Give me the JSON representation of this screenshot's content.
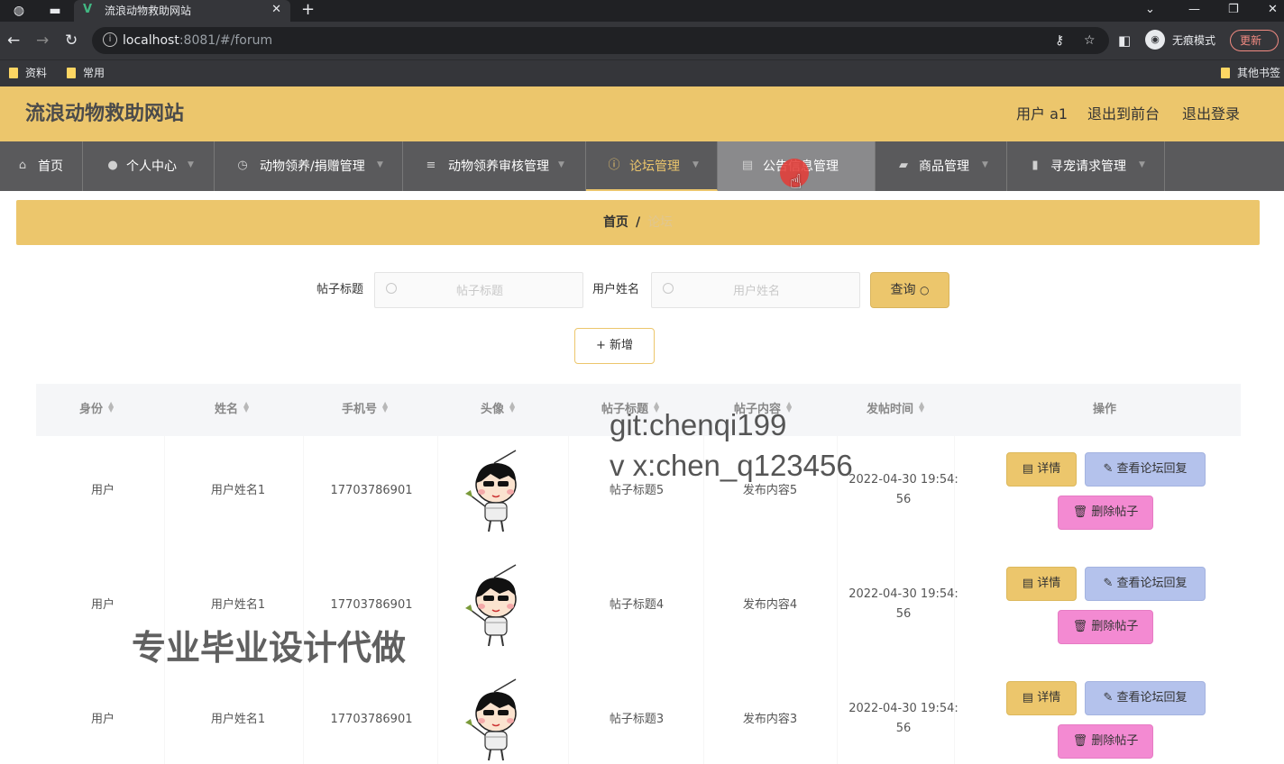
{
  "browser": {
    "tab_title": "流浪动物救助网站",
    "url_host": "localhost",
    "url_rest": ":8081/#/forum",
    "incognito_label": "无痕模式",
    "update_label": "更新",
    "bookmarks": [
      "资料",
      "常用"
    ],
    "other_bookmarks": "其他书签"
  },
  "header": {
    "site_title": "流浪动物救助网站",
    "user_label": "用户 a1",
    "back_to_front": "退出到前台",
    "logout": "退出登录"
  },
  "menu": [
    {
      "label": "首页",
      "icon": "home-icon"
    },
    {
      "label": "个人中心",
      "icon": "user-icon"
    },
    {
      "label": "动物领养/捐赠管理",
      "icon": "clock-icon"
    },
    {
      "label": "动物领养审核管理",
      "icon": "list-icon"
    },
    {
      "label": "论坛管理",
      "icon": "info-icon"
    },
    {
      "label": "公告信息管理",
      "icon": "doc-icon"
    },
    {
      "label": "商品管理",
      "icon": "briefcase-icon"
    },
    {
      "label": "寻宠请求管理",
      "icon": "book-icon"
    }
  ],
  "breadcrumb": {
    "home": "首页",
    "separator": "/",
    "current": "论坛"
  },
  "search": {
    "title_label": "帖子标题",
    "title_placeholder": "帖子标题",
    "user_label": "用户姓名",
    "user_placeholder": "用户姓名",
    "query_button": "查询",
    "add_button": "新增"
  },
  "table": {
    "columns": [
      "身份",
      "姓名",
      "手机号",
      "头像",
      "帖子标题",
      "帖子内容",
      "发帖时间",
      "操作"
    ],
    "rows": [
      {
        "role": "用户",
        "name": "用户姓名1",
        "phone": "17703786901",
        "title": "帖子标题5",
        "content": "发布内容5",
        "time_line1": "2022-04-30 19:54:",
        "time_line2": "56"
      },
      {
        "role": "用户",
        "name": "用户姓名1",
        "phone": "17703786901",
        "title": "帖子标题4",
        "content": "发布内容4",
        "time_line1": "2022-04-30 19:54:",
        "time_line2": "56"
      },
      {
        "role": "用户",
        "name": "用户姓名1",
        "phone": "17703786901",
        "title": "帖子标题3",
        "content": "发布内容3",
        "time_line1": "2022-04-30 19:54:",
        "time_line2": "56"
      }
    ],
    "actions": {
      "detail": "详情",
      "reply": "查看论坛回复",
      "delete": "删除帖子"
    }
  },
  "watermarks": {
    "line1": "git:chenqi199",
    "line2": "v x:chen_q123456",
    "line3": "专业毕业设计代做"
  },
  "colors": {
    "accent": "#ecc66c",
    "menu_bg": "#5a5a5c",
    "reply_btn": "#b4c2ec",
    "delete_btn": "#f38ad2"
  }
}
